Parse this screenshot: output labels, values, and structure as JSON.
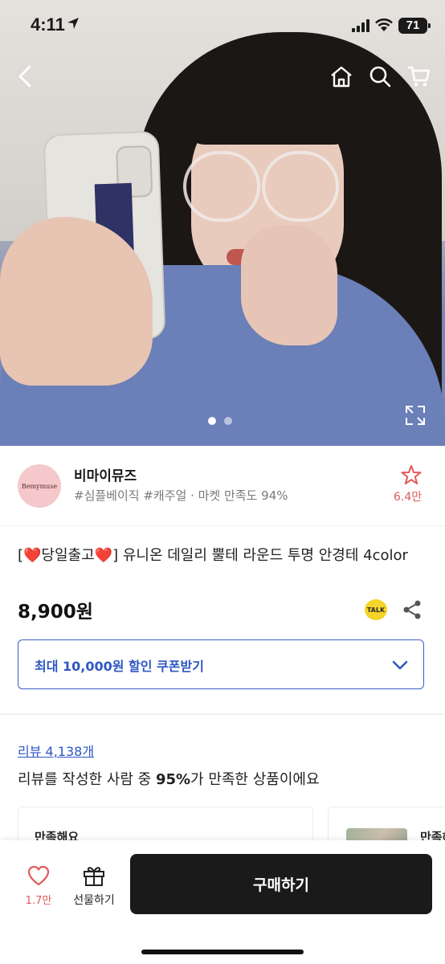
{
  "status_bar": {
    "time": "4:11",
    "battery": "71"
  },
  "product": {
    "title": "[❤️당일출고❤️] 유니온 데일리 뿔테 라운드 투명 안경테 4color",
    "price": "8,900원",
    "talk_label": "TALK",
    "coupon_label": "최대 10,000원 할인 쿠폰받기"
  },
  "shop": {
    "logo_text": "Bemymuse",
    "name": "비마이뮤즈",
    "tags": "#심플베이직 #캐주얼 · 마켓 만족도 94%",
    "follower_count": "6.4만"
  },
  "reviews": {
    "link_label": "리뷰 4,138개",
    "summary_prefix": "리뷰를 작성한 사람 중 ",
    "summary_percent": "95%",
    "summary_suffix": "가 만족한 상품이에요",
    "card1_label": "만족해요",
    "card2_label": "만족해"
  },
  "carousel": {
    "total": 2,
    "current": 1
  },
  "bottom_bar": {
    "like_count": "1.7만",
    "gift_label": "선물하기",
    "buy_label": "구매하기"
  },
  "colors": {
    "accent_blue": "#2f57c4",
    "like_red": "#e05a5a",
    "buy_black": "#1a1a1a"
  }
}
